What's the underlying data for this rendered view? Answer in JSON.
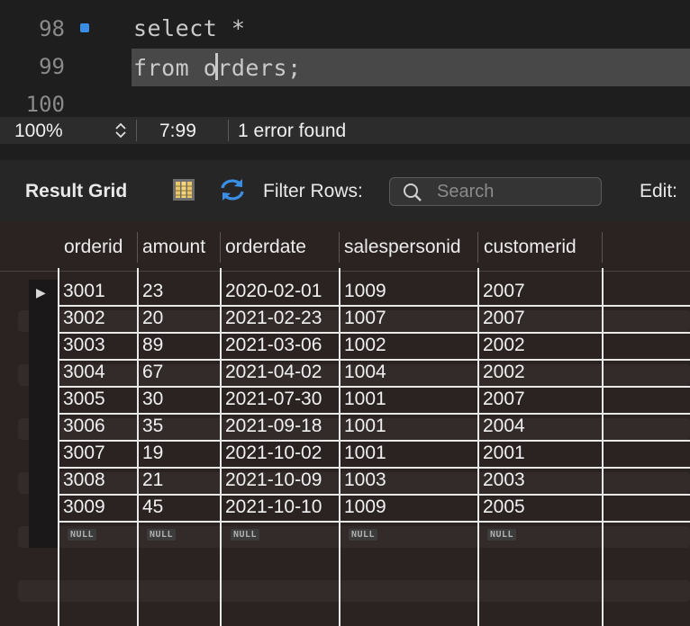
{
  "editor": {
    "lines": [
      {
        "num": "98",
        "code": "select *"
      },
      {
        "num": "99",
        "code_before_caret": "from o",
        "code_after_caret": "rders;"
      },
      {
        "num": "100",
        "code": ""
      }
    ]
  },
  "status": {
    "zoom": "100%",
    "position": "7:99",
    "message": "1 error found"
  },
  "toolbar": {
    "result_grid_label": "Result Grid",
    "filter_rows_label": "Filter Rows:",
    "search_placeholder": "Search",
    "edit_label": "Edit:"
  },
  "grid": {
    "columns": [
      "orderid",
      "amount",
      "orderdate",
      "salespersonid",
      "customerid"
    ],
    "rows": [
      [
        "3001",
        "23",
        "2020-02-01",
        "1009",
        "2007"
      ],
      [
        "3002",
        "20",
        "2021-02-23",
        "1007",
        "2007"
      ],
      [
        "3003",
        "89",
        "2021-03-06",
        "1002",
        "2002"
      ],
      [
        "3004",
        "67",
        "2021-04-02",
        "1004",
        "2002"
      ],
      [
        "3005",
        "30",
        "2021-07-30",
        "1001",
        "2007"
      ],
      [
        "3006",
        "35",
        "2021-09-18",
        "1001",
        "2004"
      ],
      [
        "3007",
        "19",
        "2021-10-02",
        "1001",
        "2001"
      ],
      [
        "3008",
        "21",
        "2021-10-09",
        "1003",
        "2003"
      ],
      [
        "3009",
        "45",
        "2021-10-10",
        "1009",
        "2005"
      ]
    ],
    "null_label": "NULL",
    "selected_row_indicator": "▶"
  },
  "colors": {
    "editor_bg": "#1e1e1e",
    "line_highlight": "#484848",
    "grid_bg": "#2a2322",
    "grid_lines": "#e8e8e8",
    "breakpoint_dot": "#3a8ee6",
    "refresh_icon": "#3a8ee6"
  }
}
